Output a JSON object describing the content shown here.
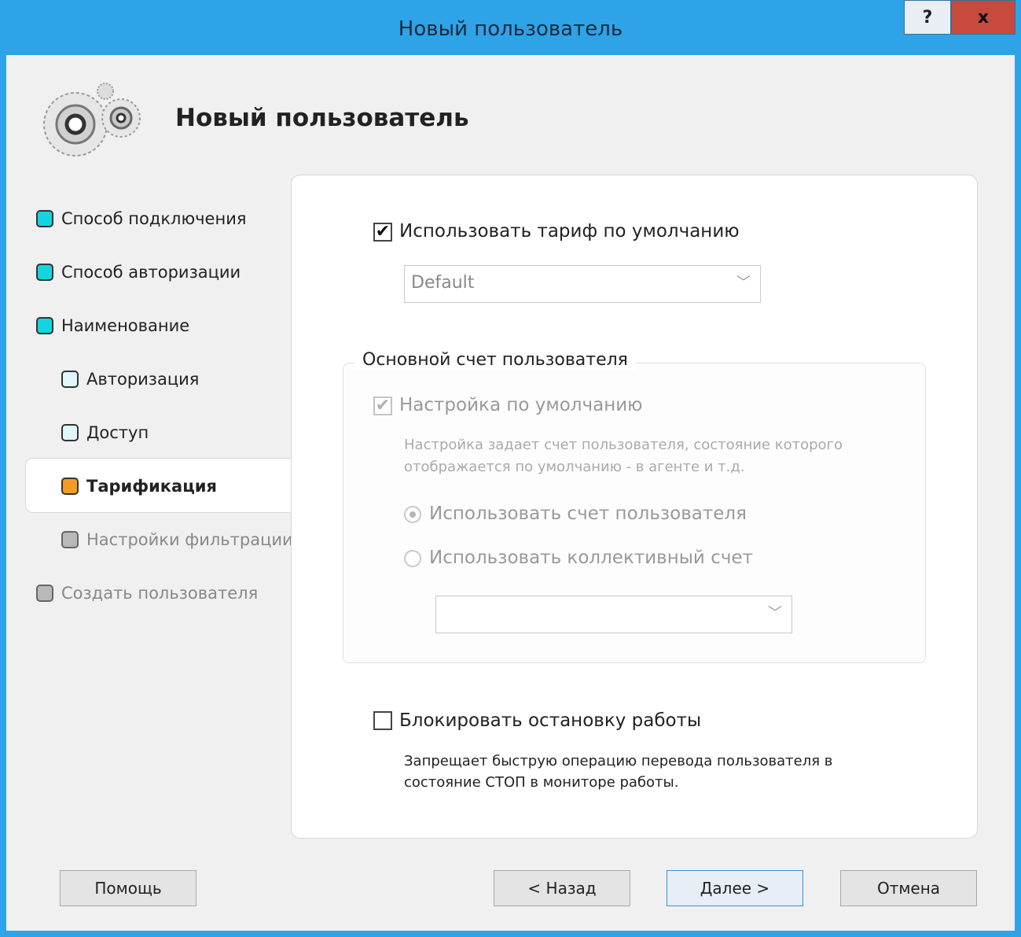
{
  "window": {
    "title": "Новый пользователь",
    "help_label": "?",
    "close_label": "x"
  },
  "header": {
    "title": "Новый пользователь",
    "logo_icon": "gears-icon"
  },
  "nav": {
    "items": [
      {
        "label": "Способ подключения",
        "state": "done"
      },
      {
        "label": "Способ авторизации",
        "state": "done"
      },
      {
        "label": "Наименование",
        "state": "done"
      },
      {
        "label": "Авторизация",
        "state": "sub-done"
      },
      {
        "label": "Доступ",
        "state": "sub-done"
      },
      {
        "label": "Тарификация",
        "state": "active"
      },
      {
        "label": "Настройки фильтрации",
        "state": "pending"
      },
      {
        "label": "Создать пользователя",
        "state": "pending"
      }
    ]
  },
  "tariff": {
    "use_default_label": "Использовать тариф по умолчанию",
    "use_default_checked": true,
    "tariff_value": "Default"
  },
  "account_group": {
    "title": "Основной счет пользователя",
    "default_setting_label": "Настройка по умолчанию",
    "default_setting_checked": true,
    "description": "Настройка задает счет пользователя, состояние которого отображается по умолчанию - в агенте и т.д.",
    "radio_user_account": "Использовать счет пользователя",
    "radio_collective_account": "Использовать коллективный счет",
    "selected_radio": "user_account",
    "collective_value": ""
  },
  "block": {
    "label": "Блокировать остановку работы",
    "checked": false,
    "description": "Запрещает быструю операцию перевода пользователя в состояние СТОП в мониторе работы."
  },
  "buttons": {
    "help": "Помощь",
    "back": "< Назад",
    "next": "Далее >",
    "cancel": "Отмена"
  },
  "colors": {
    "titlebar": "#2ea3e8",
    "step_done": "#13d5e0",
    "step_active": "#f39c23",
    "step_pending": "#b9b9b9",
    "close_button": "#c8493e"
  }
}
